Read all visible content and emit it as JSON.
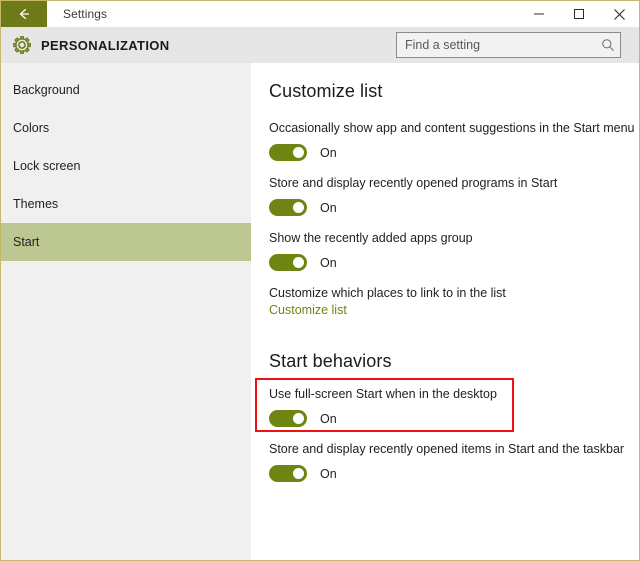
{
  "window": {
    "title": "Settings",
    "back_icon": "back-arrow-icon",
    "controls": {
      "minimize": "minimize-icon",
      "maximize": "maximize-icon",
      "close": "close-icon"
    },
    "border_color": "#c6b86b"
  },
  "header": {
    "icon": "gear-icon",
    "title": "PERSONALIZATION",
    "accent_color": "#6e7a18",
    "background": "#e6e6e6"
  },
  "search": {
    "placeholder": "Find a setting",
    "value": "",
    "icon": "search-icon"
  },
  "sidebar": {
    "background": "#f0f0f0",
    "selected_color": "#bdc791",
    "items": [
      {
        "label": "Background",
        "selected": false
      },
      {
        "label": "Colors",
        "selected": false
      },
      {
        "label": "Lock screen",
        "selected": false
      },
      {
        "label": "Themes",
        "selected": false
      },
      {
        "label": "Start",
        "selected": true
      }
    ]
  },
  "main": {
    "sections": [
      {
        "title": "Customize list",
        "settings": [
          {
            "label": "Occasionally show app and content suggestions in the Start menu",
            "state": "On",
            "on": true
          },
          {
            "label": "Store and display recently opened programs in Start",
            "state": "On",
            "on": true
          },
          {
            "label": "Show the recently added apps group",
            "state": "On",
            "on": true
          }
        ],
        "link_label": "Customize which places to link to in the list",
        "link_text": "Customize list"
      },
      {
        "title": "Start behaviors",
        "settings": [
          {
            "label": "Use full-screen Start when in the desktop",
            "state": "On",
            "on": true,
            "highlighted": true
          },
          {
            "label": "Store and display recently opened items in Start and the taskbar",
            "state": "On",
            "on": true
          }
        ]
      }
    ],
    "toggle_on_color": "#6e8511",
    "link_color": "#6e8511"
  },
  "annotation": {
    "color": "#ee1111",
    "target": "Use full-screen Start when in the desktop"
  }
}
